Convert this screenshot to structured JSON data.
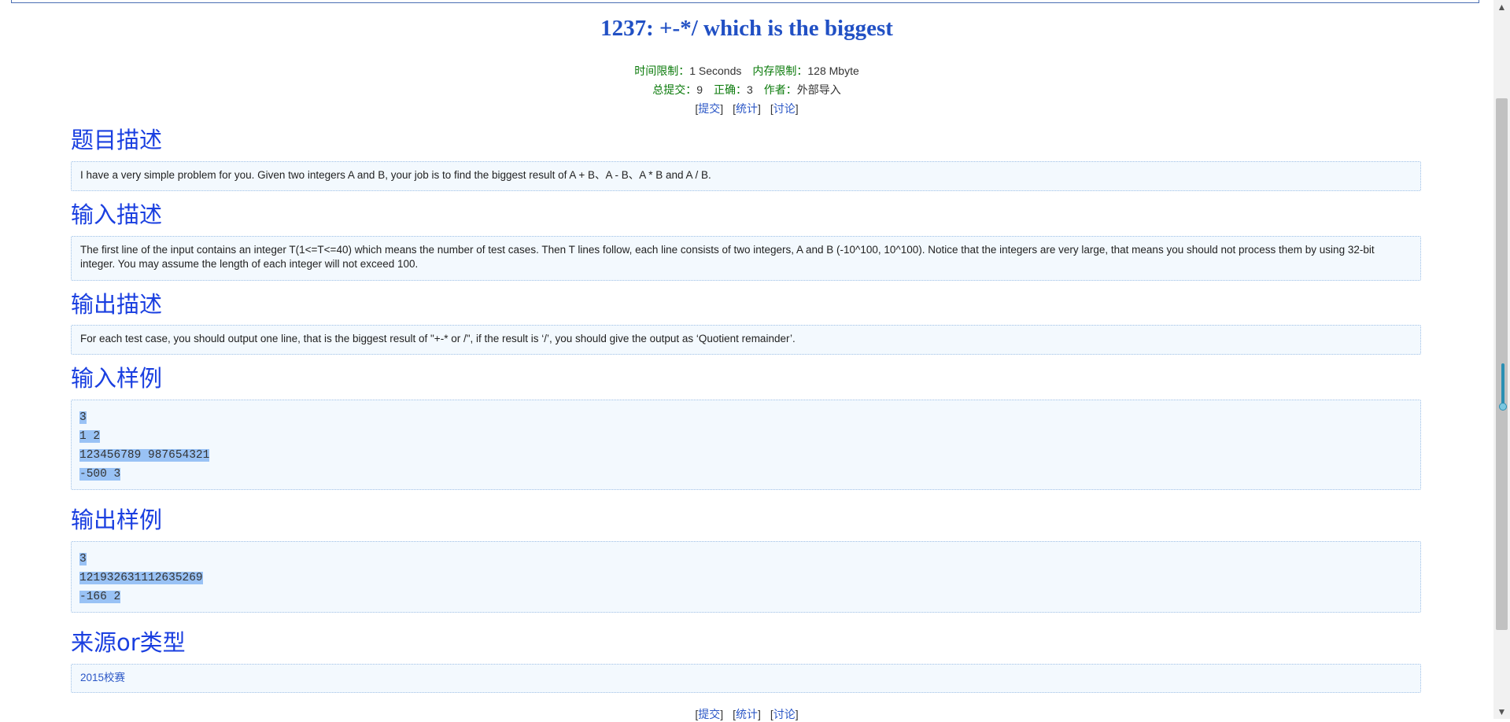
{
  "title": "1237: +-*/ which is the biggest",
  "meta": {
    "time_limit_label": "时间限制：",
    "time_limit_value": "1 Seconds",
    "memory_limit_label": "内存限制：",
    "memory_limit_value": "128 Mbyte",
    "total_submit_label": "总提交：",
    "total_submit_value": "9",
    "correct_label": "正确：",
    "correct_value": "3",
    "author_label": "作者：",
    "author_value": "外部导入"
  },
  "links": {
    "submit": "提交",
    "stats": "统计",
    "discuss": "讨论"
  },
  "sections": {
    "description": {
      "heading": "题目描述",
      "text": "I have a very simple problem for you. Given two integers A and B, your job is to find the biggest result of A + B、A - B、A * B and A / B."
    },
    "input": {
      "heading": "输入描述",
      "text": "The first line of the input contains an integer T(1<=T<=40) which means the number of test cases. Then T lines follow, each line consists of two integers, A and B (-10^100, 10^100). Notice that the integers are very large, that means you should not process them by using 32-bit integer. You may assume the length of each integer will not exceed 100."
    },
    "output": {
      "heading": "输出描述",
      "text": "For each test case, you should output one line, that is the biggest result of \"+-* or /\", if the result is ‘/’, you should give the output as ‘Quotient remainder’."
    },
    "sample_input": {
      "heading": "输入样例",
      "lines": [
        "3",
        "1 2",
        "123456789 987654321",
        "-500 3"
      ]
    },
    "sample_output": {
      "heading": "输出样例",
      "lines": [
        "3",
        "121932631112635269",
        "-166 2"
      ]
    },
    "source": {
      "heading": "来源or类型",
      "text": "2015校赛"
    }
  },
  "scrollbar": {
    "up_icon": "chevron-up-icon",
    "down_icon": "chevron-down-icon"
  }
}
